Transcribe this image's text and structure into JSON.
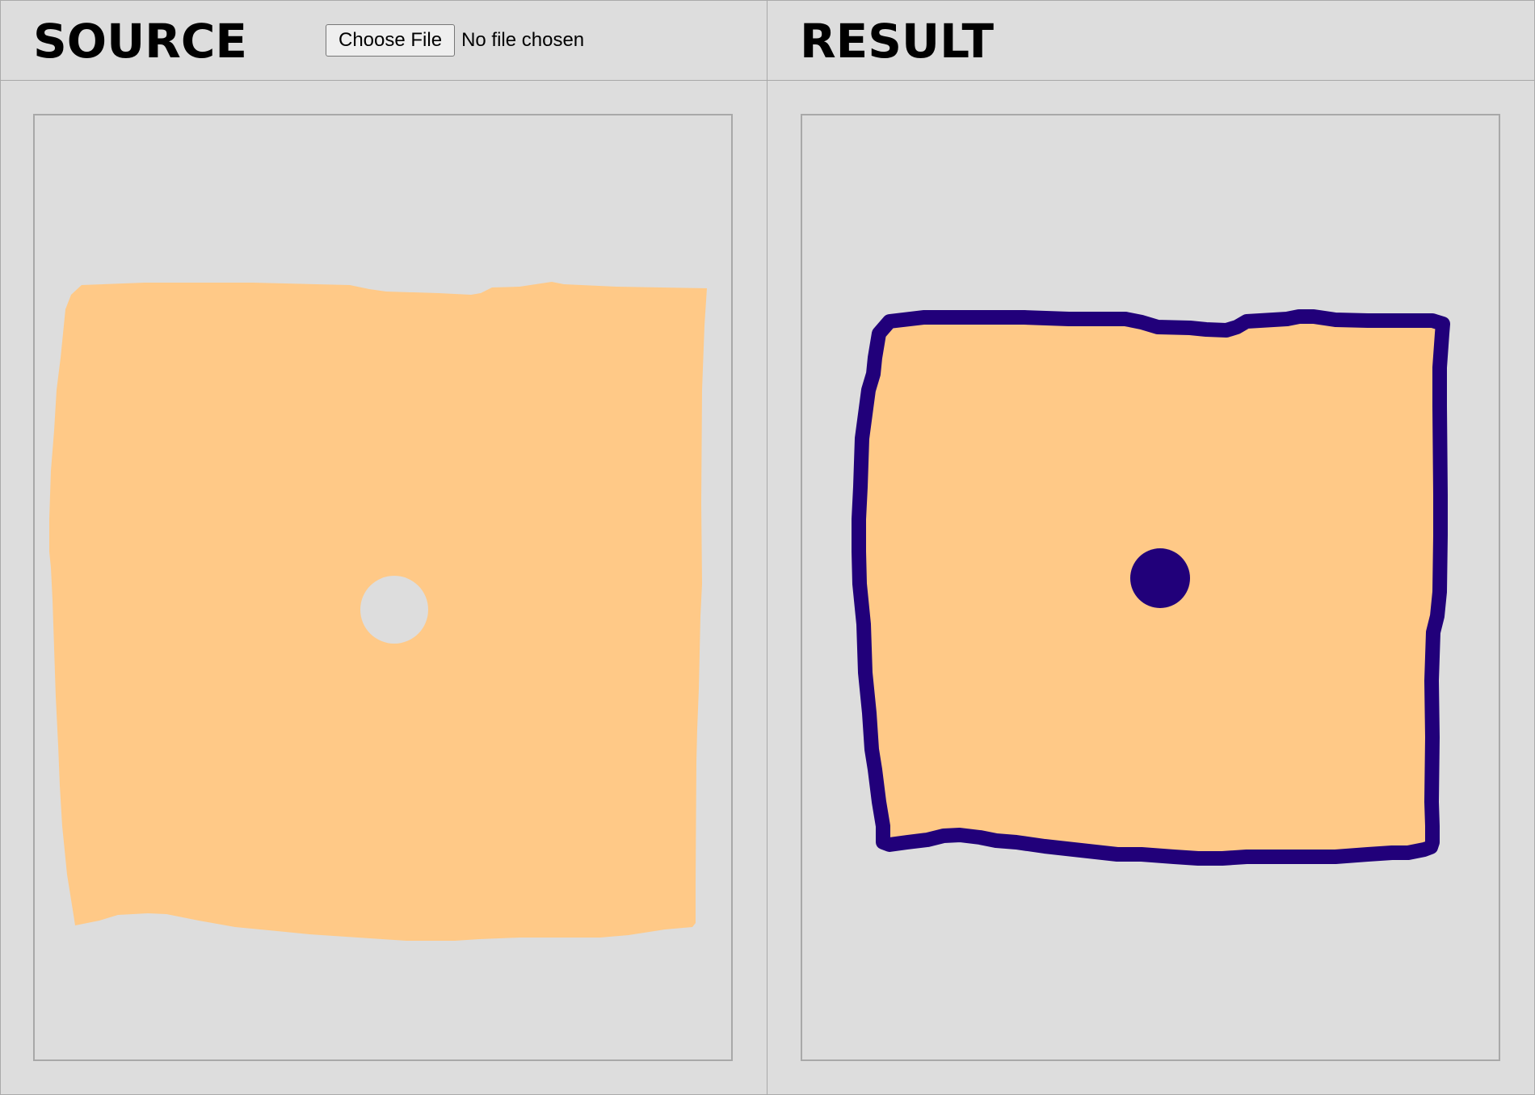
{
  "source_panel": {
    "title": "SOURCE",
    "file_input": {
      "button_label": "Choose File",
      "status": "No file chosen"
    }
  },
  "result_panel": {
    "title": "RESULT"
  },
  "colors": {
    "background": "#dddddd",
    "shape_fill": "#ffc987",
    "outline": "#21007a",
    "frame_border": "#a8a8a8"
  }
}
